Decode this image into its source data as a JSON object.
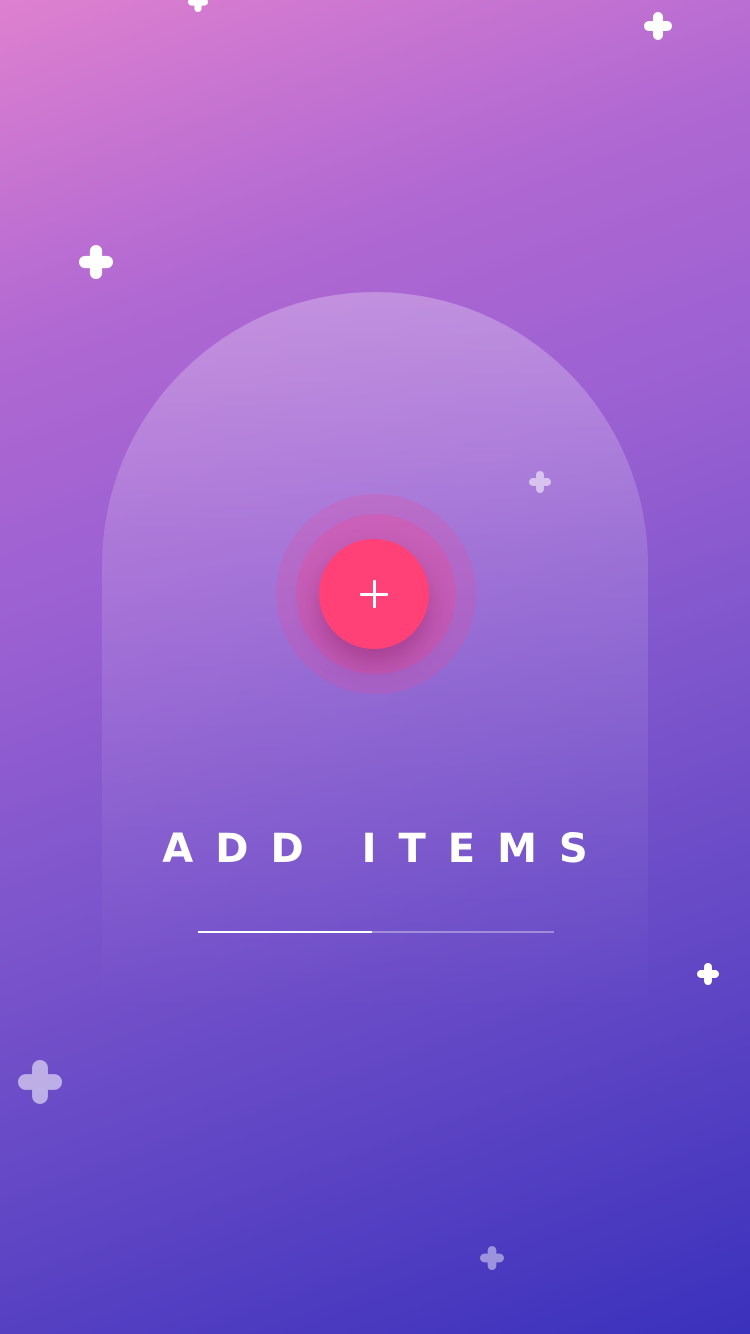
{
  "screen": {
    "title": "ADD ITEMS",
    "progress": 0.49
  },
  "add_button": {
    "icon": "plus-icon"
  },
  "colors": {
    "background_top": "#de80d0",
    "background_bottom": "#3a31bc",
    "accent": "#ff4178",
    "text": "#ffffff"
  },
  "decorations": [
    "sparkle-icon"
  ]
}
